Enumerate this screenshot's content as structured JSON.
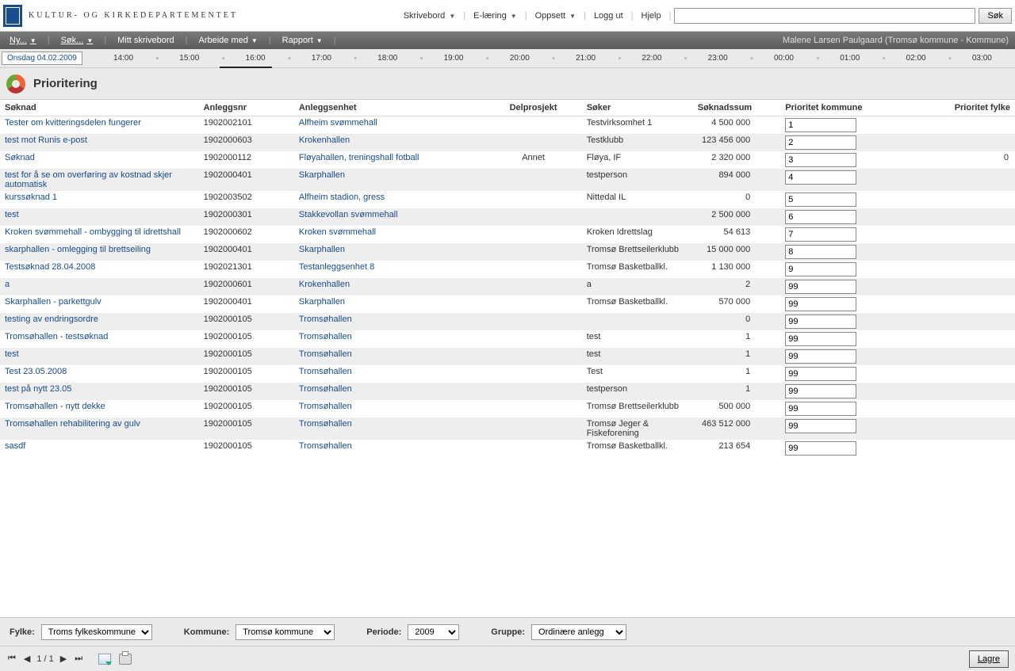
{
  "header": {
    "org_name": "KULTUR- OG KIRKEDEPARTEMENTET",
    "nav": [
      "Skrivebord",
      "E-læring",
      "Oppsett",
      "Logg ut",
      "Hjelp"
    ],
    "search_btn": "Søk"
  },
  "menubar": {
    "left": [
      "Ny...",
      "Søk...",
      "Mitt skrivebord",
      "Arbeide med",
      "Rapport"
    ],
    "user": "Malene Larsen Paulgaard (Tromsø kommune - Kommune)"
  },
  "timeline": {
    "date": "Onsdag 04.02.2009",
    "hours": [
      "14:00",
      "15:00",
      "16:00",
      "17:00",
      "18:00",
      "19:00",
      "20:00",
      "21:00",
      "22:00",
      "23:00",
      "00:00",
      "01:00",
      "02:00",
      "03:00"
    ]
  },
  "page_title": "Prioritering",
  "columns": {
    "soknad": "Søknad",
    "anleggsnr": "Anleggsnr",
    "enhet": "Anleggsenhet",
    "delpro": "Delprosjekt",
    "soker": "Søker",
    "sum": "Søknadssum",
    "priok": "Prioritet kommune",
    "priof": "Prioritet fylke"
  },
  "rows": [
    {
      "soknad": "Tester om kvitteringsdelen fungerer",
      "anleggsnr": "1902002101",
      "enhet": "Alfheim svømmehall",
      "delpro": "",
      "soker": "Testvirksomhet 1",
      "sum": "4 500 000",
      "priok": "1",
      "priof": ""
    },
    {
      "soknad": "test mot Runis e-post",
      "anleggsnr": "1902000603",
      "enhet": "Krokenhallen",
      "delpro": "",
      "soker": "Testklubb",
      "sum": "123 456 000",
      "priok": "2",
      "priof": ""
    },
    {
      "soknad": "Søknad",
      "anleggsnr": "1902000112",
      "enhet": "Fløyahallen, treningshall fotball",
      "delpro": "Annet",
      "soker": "Fløya, IF",
      "sum": "2 320 000",
      "priok": "3",
      "priof": "0"
    },
    {
      "soknad": "test for å se om overføring av kostnad skjer automatisk",
      "anleggsnr": "1902000401",
      "enhet": "Skarphallen",
      "delpro": "",
      "soker": "testperson",
      "sum": "894 000",
      "priok": "4",
      "priof": ""
    },
    {
      "soknad": "kurssøknad 1",
      "anleggsnr": "1902003502",
      "enhet": "Alfheim stadion, gress",
      "delpro": "",
      "soker": "Nittedal IL",
      "sum": "0",
      "priok": "5",
      "priof": ""
    },
    {
      "soknad": "test",
      "anleggsnr": "1902000301",
      "enhet": "Stakkevollan svømmehall",
      "delpro": "",
      "soker": "",
      "sum": "2 500 000",
      "priok": "6",
      "priof": ""
    },
    {
      "soknad": "Kroken svømmehall - ombygging til idrettshall",
      "anleggsnr": "1902000602",
      "enhet": "Kroken svømmehall",
      "delpro": "",
      "soker": "Kroken Idrettslag",
      "sum": "54 613",
      "priok": "7",
      "priof": ""
    },
    {
      "soknad": "skarphallen - omlegging til brettseiling",
      "anleggsnr": "1902000401",
      "enhet": "Skarphallen",
      "delpro": "",
      "soker": "Tromsø Brettseilerklubb",
      "sum": "15 000 000",
      "priok": "8",
      "priof": ""
    },
    {
      "soknad": "Testsøknad 28.04.2008",
      "anleggsnr": "1902021301",
      "enhet": "Testanleggsenhet 8",
      "delpro": "",
      "soker": "Tromsø Basketballkl.",
      "sum": "1 130 000",
      "priok": "9",
      "priof": ""
    },
    {
      "soknad": "a",
      "anleggsnr": "1902000601",
      "enhet": "Krokenhallen",
      "delpro": "",
      "soker": "a",
      "sum": "2",
      "priok": "99",
      "priof": ""
    },
    {
      "soknad": "Skarphallen - parkettgulv",
      "anleggsnr": "1902000401",
      "enhet": "Skarphallen",
      "delpro": "",
      "soker": "Tromsø Basketballkl.",
      "sum": "570 000",
      "priok": "99",
      "priof": ""
    },
    {
      "soknad": "testing av endringsordre",
      "anleggsnr": "1902000105",
      "enhet": "Tromsøhallen",
      "delpro": "",
      "soker": "",
      "sum": "0",
      "priok": "99",
      "priof": ""
    },
    {
      "soknad": "Tromsøhallen - testsøknad",
      "anleggsnr": "1902000105",
      "enhet": "Tromsøhallen",
      "delpro": "",
      "soker": "test",
      "sum": "1",
      "priok": "99",
      "priof": ""
    },
    {
      "soknad": "test",
      "anleggsnr": "1902000105",
      "enhet": "Tromsøhallen",
      "delpro": "",
      "soker": "test",
      "sum": "1",
      "priok": "99",
      "priof": ""
    },
    {
      "soknad": "Test 23.05.2008",
      "anleggsnr": "1902000105",
      "enhet": "Tromsøhallen",
      "delpro": "",
      "soker": "Test",
      "sum": "1",
      "priok": "99",
      "priof": ""
    },
    {
      "soknad": "test på nytt 23.05",
      "anleggsnr": "1902000105",
      "enhet": "Tromsøhallen",
      "delpro": "",
      "soker": "testperson",
      "sum": "1",
      "priok": "99",
      "priof": ""
    },
    {
      "soknad": "Tromsøhallen - nytt dekke",
      "anleggsnr": "1902000105",
      "enhet": "Tromsøhallen",
      "delpro": "",
      "soker": "Tromsø Brettseilerklubb",
      "sum": "500 000",
      "priok": "99",
      "priof": ""
    },
    {
      "soknad": "Tromsøhallen rehabilitering av gulv",
      "anleggsnr": "1902000105",
      "enhet": "Tromsøhallen",
      "delpro": "",
      "soker": "Tromsø Jeger & Fiskeforening",
      "sum": "463 512 000",
      "priok": "99",
      "priof": ""
    },
    {
      "soknad": "sasdf",
      "anleggsnr": "1902000105",
      "enhet": "Tromsøhallen",
      "delpro": "",
      "soker": "Tromsø Basketballkl.",
      "sum": "213 654",
      "priok": "99",
      "priof": ""
    }
  ],
  "filters": {
    "fylke_label": "Fylke:",
    "fylke_value": "Troms fylkeskommune",
    "kommune_label": "Kommune:",
    "kommune_value": "Tromsø kommune",
    "periode_label": "Periode:",
    "periode_value": "2009",
    "gruppe_label": "Gruppe:",
    "gruppe_value": "Ordinære anlegg"
  },
  "pager": {
    "text": "1 / 1"
  },
  "save_btn": "Lagre"
}
